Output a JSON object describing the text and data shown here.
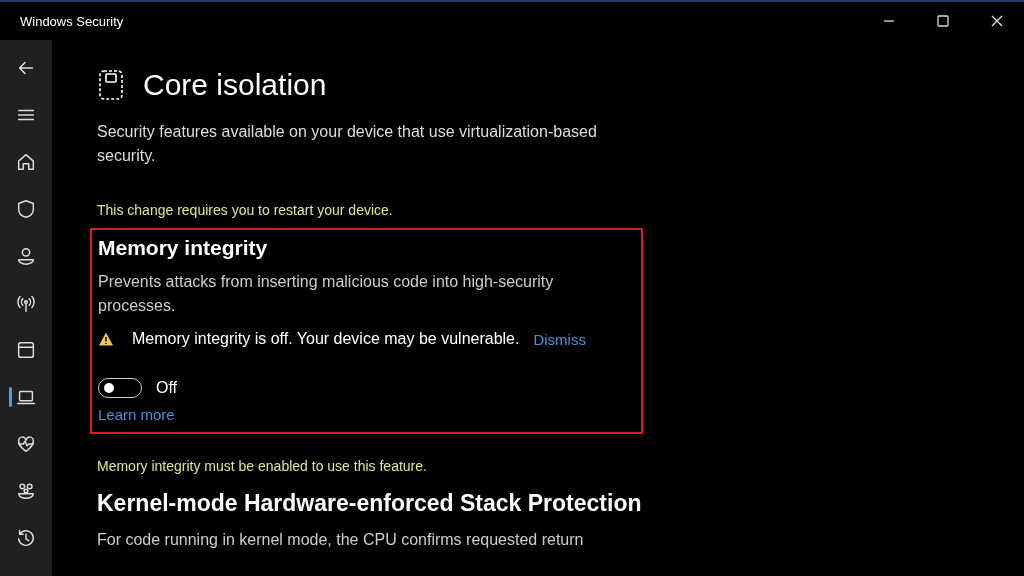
{
  "window": {
    "title": "Windows Security"
  },
  "sidebar": {
    "items": [
      {
        "kind": "back",
        "selected": false
      },
      {
        "kind": "menu",
        "selected": false
      },
      {
        "kind": "home",
        "selected": false
      },
      {
        "kind": "shield",
        "selected": false
      },
      {
        "kind": "person",
        "selected": false
      },
      {
        "kind": "antenna",
        "selected": false
      },
      {
        "kind": "window",
        "selected": false
      },
      {
        "kind": "laptop",
        "selected": true
      },
      {
        "kind": "heart",
        "selected": false
      },
      {
        "kind": "family",
        "selected": false
      },
      {
        "kind": "history",
        "selected": false
      }
    ]
  },
  "page": {
    "title": "Core isolation",
    "description": "Security features available on your device that use virtualization-based security.",
    "restart_note": "This change requires you to restart your device."
  },
  "memory_integrity": {
    "title": "Memory integrity",
    "description": "Prevents attacks from inserting malicious code into high-security processes.",
    "warning": "Memory integrity is off. Your device may be vulnerable.",
    "dismiss": "Dismiss",
    "toggle": {
      "on": false,
      "label": "Off"
    },
    "learn_more": "Learn more",
    "highlighted": true
  },
  "requirement_note": "Memory integrity must be enabled to use this feature.",
  "stack_protection": {
    "title": "Kernel-mode Hardware-enforced Stack Protection",
    "description": "For code running in kernel mode, the CPU confirms requested return"
  }
}
